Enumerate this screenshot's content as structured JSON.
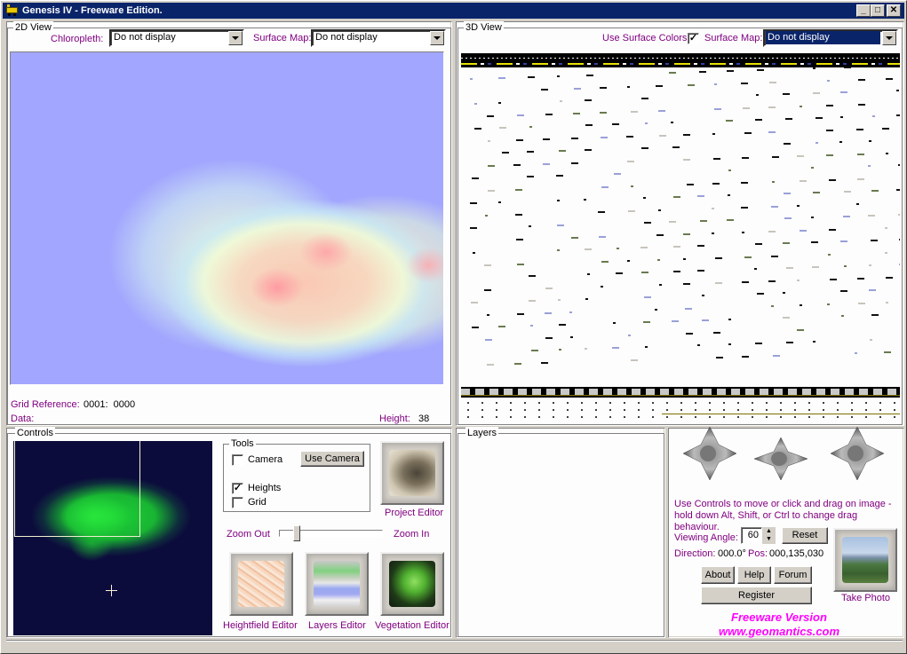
{
  "window": {
    "title": "Genesis IV - Freeware Edition.",
    "app_icon": "steam-engine-icon",
    "controls": {
      "minimize": "_",
      "maximize": "□",
      "close": "✕"
    }
  },
  "view2d": {
    "group_label": "2D View",
    "chloropleth_label": "Chloropleth:",
    "chloropleth_value": "Do not display",
    "surface_map_label": "Surface Map:",
    "surface_map_value": "Do not display",
    "grid_reference_label": "Grid Reference:",
    "grid_reference_value": "0001:  0000",
    "data_label": "Data:",
    "data_value": "",
    "height_label": "Height:",
    "height_value": "38"
  },
  "view3d": {
    "group_label": "3D View",
    "use_surface_colors_label": "Use Surface Colors",
    "use_surface_colors_checked": true,
    "surface_map_label": "Surface Map:",
    "surface_map_value": "Do not display"
  },
  "controls": {
    "group_label": "Controls",
    "tools": {
      "group_label": "Tools",
      "camera_label": "Camera",
      "camera_checked": false,
      "use_camera_button": "Use Camera",
      "heights_label": "Heights",
      "heights_checked": true,
      "grid_label": "Grid",
      "grid_checked": false
    },
    "project_editor_label": "Project Editor",
    "zoom_out_label": "Zoom Out",
    "zoom_in_label": "Zoom In",
    "zoom_level_fraction": 0.15,
    "editors": [
      {
        "label": "Heightfield Editor",
        "icon": "heightfield-map-icon"
      },
      {
        "label": "Layers Editor",
        "icon": "layers-landscape-icon"
      },
      {
        "label": "Vegetation Editor",
        "icon": "vegetation-leaves-icon"
      }
    ]
  },
  "layers": {
    "group_label": "Layers"
  },
  "navigation": {
    "joysticks": [
      "move-joystick-icon",
      "rotate-joystick-icon",
      "tilt-joystick-icon"
    ],
    "hint": "Use Controls to move or click and drag on image - hold down Alt, Shift, or Ctrl to change drag behaviour.",
    "viewing_angle_label": "Viewing Angle:",
    "viewing_angle_value": "60",
    "reset_button": "Reset",
    "direction_label": "Direction:",
    "direction_value": "000.0°",
    "pos_label": "Pos:",
    "pos_value": "000,135,030",
    "about_button": "About",
    "help_button": "Help",
    "forum_button": "Forum",
    "register_button": "Register",
    "take_photo_label": "Take Photo",
    "freeware_line1": "Freeware Version",
    "freeware_line2": "www.geomantics.com"
  },
  "colors": {
    "label_purple": "#800080",
    "freeware_magenta": "#ff00ff",
    "titlebar": "#0a246a",
    "water_blue": "#a2a6fe",
    "minimap_bg": "#0c0c3c",
    "minimap_green": "#22dd44"
  }
}
